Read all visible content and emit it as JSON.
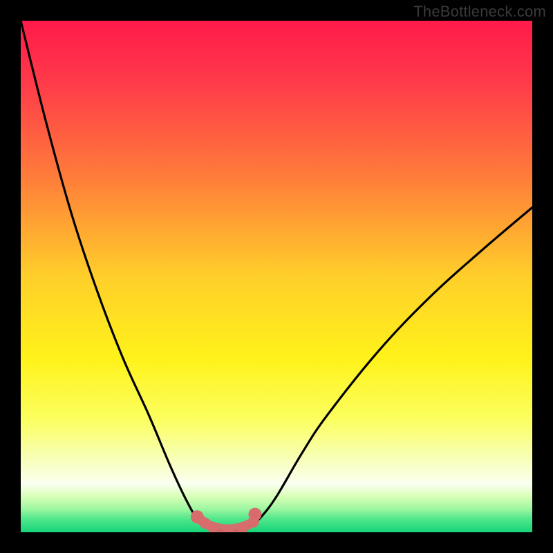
{
  "watermark": "TheBottleneck.com",
  "chart_data": {
    "type": "line",
    "title": "",
    "xlabel": "",
    "ylabel": "",
    "xlim": [
      0,
      1
    ],
    "ylim": [
      0,
      1
    ],
    "series": [
      {
        "name": "left-curve",
        "x": [
          0.0,
          0.05,
          0.1,
          0.15,
          0.2,
          0.25,
          0.29,
          0.32,
          0.345,
          0.355
        ],
        "y": [
          1.0,
          0.8,
          0.62,
          0.47,
          0.34,
          0.23,
          0.135,
          0.07,
          0.025,
          0.018
        ]
      },
      {
        "name": "flat-minimum",
        "x": [
          0.355,
          0.375,
          0.405,
          0.435,
          0.455
        ],
        "y": [
          0.018,
          0.006,
          0.003,
          0.006,
          0.018
        ]
      },
      {
        "name": "right-curve",
        "x": [
          0.455,
          0.47,
          0.5,
          0.55,
          0.6,
          0.7,
          0.8,
          0.9,
          1.0
        ],
        "y": [
          0.018,
          0.03,
          0.07,
          0.155,
          0.23,
          0.355,
          0.46,
          0.55,
          0.635
        ]
      },
      {
        "name": "minimum-markers",
        "x": [
          0.345,
          0.36,
          0.375,
          0.405,
          0.435,
          0.455,
          0.458
        ],
        "y": [
          0.03,
          0.018,
          0.01,
          0.005,
          0.01,
          0.02,
          0.035
        ]
      }
    ],
    "gradient_stops": [
      {
        "offset": 0.0,
        "color": "#ff1a4a"
      },
      {
        "offset": 0.12,
        "color": "#ff3a4a"
      },
      {
        "offset": 0.3,
        "color": "#ff7a3a"
      },
      {
        "offset": 0.5,
        "color": "#ffcf2a"
      },
      {
        "offset": 0.66,
        "color": "#fff21a"
      },
      {
        "offset": 0.78,
        "color": "#fbff60"
      },
      {
        "offset": 0.85,
        "color": "#f8ffb0"
      },
      {
        "offset": 0.905,
        "color": "#fafff0"
      },
      {
        "offset": 0.93,
        "color": "#d8ffb8"
      },
      {
        "offset": 0.955,
        "color": "#9cf6a0"
      },
      {
        "offset": 0.975,
        "color": "#4de68a"
      },
      {
        "offset": 1.0,
        "color": "#16d47a"
      }
    ],
    "marker_color": "#d86b6b",
    "curve_color": "#000000"
  }
}
